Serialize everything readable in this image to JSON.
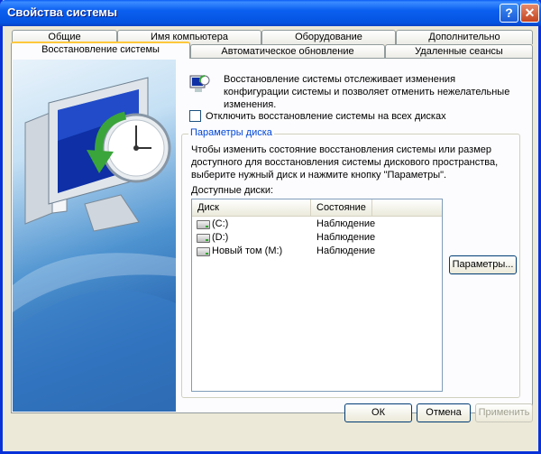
{
  "window": {
    "title": "Свойства системы"
  },
  "titlebar": {
    "help_label": "?",
    "close_label": "✕"
  },
  "tabs": {
    "row1": [
      "Общие",
      "Имя компьютера",
      "Оборудование",
      "Дополнительно"
    ],
    "row2": [
      "Восстановление системы",
      "Автоматическое обновление",
      "Удаленные сеансы"
    ]
  },
  "content": {
    "info_text": "Восстановление системы отслеживает изменения конфигурации системы и позволяет отменить нежелательные изменения.",
    "disable_checkbox_label": "Отключить восстановление системы на всех дисках",
    "disable_checked": false,
    "group": {
      "title": "Параметры диска",
      "description": "Чтобы изменить состояние восстановления системы или размер доступного для восстановления системы дискового пространства, выберите нужный диск и нажмите кнопку \"Параметры\".",
      "drives_label": "Доступные диски:",
      "columns": [
        "Диск",
        "Состояние"
      ],
      "drives": [
        {
          "name": "(C:)",
          "status": "Наблюдение",
          "icon": "drive-icon"
        },
        {
          "name": "(D:)",
          "status": "Наблюдение",
          "icon": "drive-icon"
        },
        {
          "name": "Новый том (M:)",
          "status": "Наблюдение",
          "icon": "drive-icon"
        }
      ],
      "settings_button": "Параметры..."
    }
  },
  "footer": {
    "ok": "ОК",
    "cancel": "Отмена",
    "apply": "Применить"
  },
  "colors": {
    "titlebar": "#0553e0",
    "active_tab_highlight": "#ffc83c",
    "group_title": "#0046d5"
  }
}
